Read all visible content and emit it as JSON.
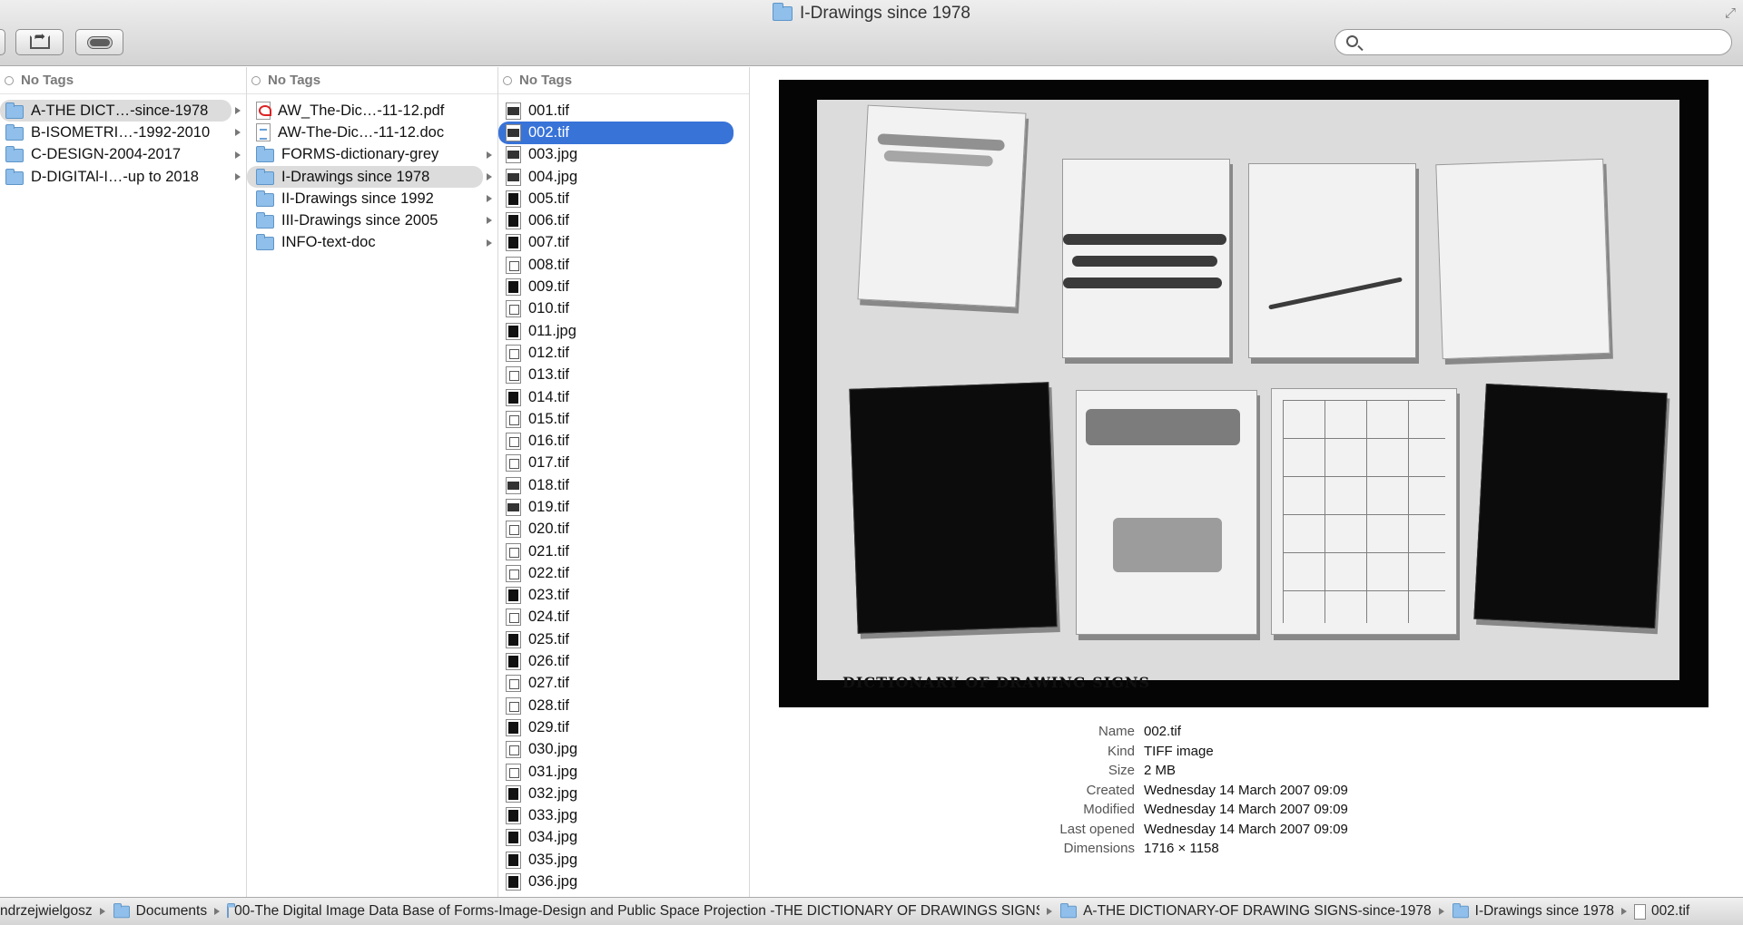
{
  "window": {
    "title": "I-Drawings since 1978"
  },
  "search": {
    "placeholder": ""
  },
  "columns": [
    {
      "header": "No Tags",
      "items": [
        {
          "label": "A-THE DICT…-since-1978",
          "type": "folder",
          "state": "grey"
        },
        {
          "label": "B-ISOMETRI…-1992-2010",
          "type": "folder",
          "state": ""
        },
        {
          "label": "C-DESIGN-2004-2017",
          "type": "folder",
          "state": ""
        },
        {
          "label": "D-DIGITAl-I…-up to 2018",
          "type": "folder",
          "state": ""
        }
      ]
    },
    {
      "header": "No Tags",
      "items": [
        {
          "label": "AW_The-Dic…-11-12.pdf",
          "type": "pdf",
          "state": ""
        },
        {
          "label": "AW-The-Dic…-11-12.doc",
          "type": "doc",
          "state": ""
        },
        {
          "label": "FORMS-dictionary-grey",
          "type": "folder",
          "state": ""
        },
        {
          "label": "I-Drawings since 1978",
          "type": "folder",
          "state": "grey"
        },
        {
          "label": "II-Drawings since 1992",
          "type": "folder",
          "state": ""
        },
        {
          "label": "III-Drawings since 2005",
          "type": "folder",
          "state": ""
        },
        {
          "label": "INFO-text-doc",
          "type": "folder",
          "state": ""
        }
      ]
    },
    {
      "header": "No Tags",
      "items": [
        {
          "label": "001.tif",
          "type": "thumb-wide",
          "state": ""
        },
        {
          "label": "002.tif",
          "type": "thumb-wide",
          "state": "blue"
        },
        {
          "label": "003.jpg",
          "type": "thumb-wide",
          "state": ""
        },
        {
          "label": "004.jpg",
          "type": "thumb-wide",
          "state": ""
        },
        {
          "label": "005.tif",
          "type": "thumb-dark",
          "state": ""
        },
        {
          "label": "006.tif",
          "type": "thumb-dark",
          "state": ""
        },
        {
          "label": "007.tif",
          "type": "thumb-dark",
          "state": ""
        },
        {
          "label": "008.tif",
          "type": "thumb-light",
          "state": ""
        },
        {
          "label": "009.tif",
          "type": "thumb-dark",
          "state": ""
        },
        {
          "label": "010.tif",
          "type": "thumb-light",
          "state": ""
        },
        {
          "label": "011.jpg",
          "type": "thumb-dark",
          "state": ""
        },
        {
          "label": "012.tif",
          "type": "thumb-light",
          "state": ""
        },
        {
          "label": "013.tif",
          "type": "thumb-light",
          "state": ""
        },
        {
          "label": "014.tif",
          "type": "thumb-dark",
          "state": ""
        },
        {
          "label": "015.tif",
          "type": "thumb-light",
          "state": ""
        },
        {
          "label": "016.tif",
          "type": "thumb-light",
          "state": ""
        },
        {
          "label": "017.tif",
          "type": "thumb-light",
          "state": ""
        },
        {
          "label": "018.tif",
          "type": "thumb-wide",
          "state": ""
        },
        {
          "label": "019.tif",
          "type": "thumb-wide",
          "state": ""
        },
        {
          "label": "020.tif",
          "type": "thumb-light",
          "state": ""
        },
        {
          "label": "021.tif",
          "type": "thumb-light",
          "state": ""
        },
        {
          "label": "022.tif",
          "type": "thumb-light",
          "state": ""
        },
        {
          "label": "023.tif",
          "type": "thumb-dark",
          "state": ""
        },
        {
          "label": "024.tif",
          "type": "thumb-light",
          "state": ""
        },
        {
          "label": "025.tif",
          "type": "thumb-dark",
          "state": ""
        },
        {
          "label": "026.tif",
          "type": "thumb-dark",
          "state": ""
        },
        {
          "label": "027.tif",
          "type": "thumb-light",
          "state": ""
        },
        {
          "label": "028.tif",
          "type": "thumb-light",
          "state": ""
        },
        {
          "label": "029.tif",
          "type": "thumb-dark",
          "state": ""
        },
        {
          "label": "030.jpg",
          "type": "thumb-light",
          "state": ""
        },
        {
          "label": "031.jpg",
          "type": "thumb-light",
          "state": ""
        },
        {
          "label": "032.jpg",
          "type": "thumb-dark",
          "state": ""
        },
        {
          "label": "033.jpg",
          "type": "thumb-dark",
          "state": ""
        },
        {
          "label": "034.jpg",
          "type": "thumb-dark",
          "state": ""
        },
        {
          "label": "035.jpg",
          "type": "thumb-dark",
          "state": ""
        },
        {
          "label": "036.jpg",
          "type": "thumb-dark",
          "state": ""
        }
      ]
    }
  ],
  "preview": {
    "image_caption": "DICTIONARY OF DRAWING SIGNS",
    "info": [
      {
        "label": "Name",
        "value": "002.tif"
      },
      {
        "label": "Kind",
        "value": "TIFF image"
      },
      {
        "label": "Size",
        "value": "2 MB"
      },
      {
        "label": "Created",
        "value": "Wednesday 14 March 2007 09:09"
      },
      {
        "label": "Modified",
        "value": "Wednesday 14 March 2007 09:09"
      },
      {
        "label": "Last opened",
        "value": "Wednesday 14 March 2007 09:09"
      },
      {
        "label": "Dimensions",
        "value": "1716 × 1158"
      }
    ]
  },
  "pathbar": [
    {
      "label": "ndrzejwielgosz",
      "icon": "none"
    },
    {
      "label": "Documents",
      "icon": "folder"
    },
    {
      "label": "00-The Digital Image Data Base of Forms-Image-Design and Public Space Projection -THE DICTIONARY OF DRAWINGS SIGNS",
      "icon": "folder"
    },
    {
      "label": "A-THE DICTIONARY-OF DRAWING SIGNS-since-1978",
      "icon": "folder"
    },
    {
      "label": "I-Drawings since 1978",
      "icon": "folder"
    },
    {
      "label": "002.tif",
      "icon": "file"
    }
  ],
  "colors": {
    "selection_blue": "#3873d8",
    "selection_grey": "#dcdcdc",
    "folder": "#8fbfea"
  },
  "icons": [
    "folder-icon",
    "share-icon",
    "tag-icon",
    "search-icon",
    "resize-icon",
    "pdf-file-icon",
    "doc-file-icon",
    "image-thumbnail-icon"
  ]
}
